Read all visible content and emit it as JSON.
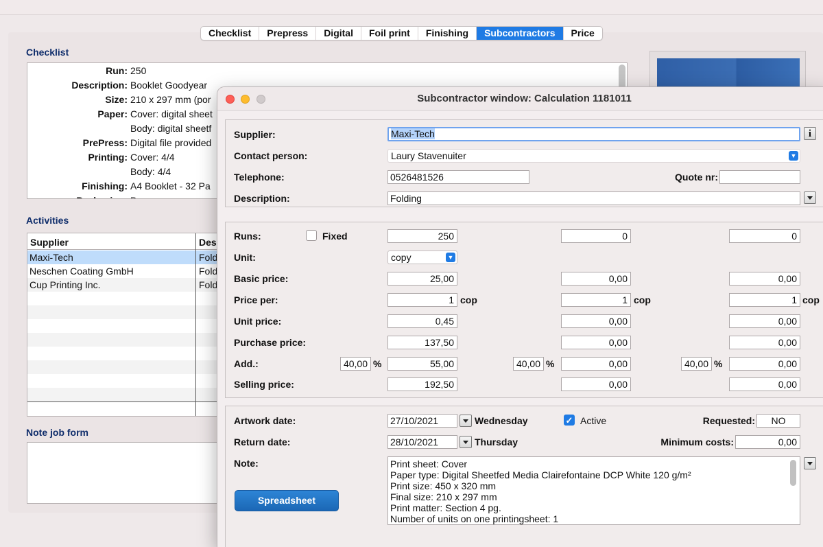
{
  "tabs": [
    "Checklist",
    "Prepress",
    "Digital",
    "Foil print",
    "Finishing",
    "Subcontractors",
    "Price"
  ],
  "active_tab": "Subcontractors",
  "checklist": {
    "title": "Checklist",
    "rows": [
      {
        "label": "Run:",
        "value": "250"
      },
      {
        "label": "Description:",
        "value": "Booklet Goodyear"
      },
      {
        "label": "Size:",
        "value": "210 x 297 mm (por"
      },
      {
        "label": "Paper:",
        "value": "Cover: digital sheet"
      },
      {
        "label": "",
        "value": "Body: digital sheetf"
      },
      {
        "label": "PrePress:",
        "value": "Digital file provided"
      },
      {
        "label": "Printing:",
        "value": "Cover: 4/4"
      },
      {
        "label": "",
        "value": "Body: 4/4"
      },
      {
        "label": "Finishing:",
        "value": "A4 Booklet - 32 Pa"
      },
      {
        "label": "Packaging:",
        "value": "Box"
      }
    ]
  },
  "activities": {
    "title": "Activities",
    "col_supplier": "Supplier",
    "col_desc": "Des",
    "rows": [
      {
        "supplier": "Maxi-Tech",
        "desc": "Fold"
      },
      {
        "supplier": "Neschen Coating GmbH",
        "desc": "Fold"
      },
      {
        "supplier": "Cup Printing Inc.",
        "desc": "Fold"
      }
    ]
  },
  "note_job_form": {
    "title": "Note job form"
  },
  "window": {
    "title": "Subcontractor window: Calculation 1181011",
    "supplier_label": "Supplier:",
    "supplier_value": "Maxi-Tech",
    "info_label": "i",
    "contact_label": "Contact person:",
    "contact_value": "Laury Stavenuiter",
    "telephone_label": "Telephone:",
    "telephone_value": "0526481526",
    "quote_label": "Quote nr:",
    "quote_value": "",
    "description_label": "Description:",
    "description_value": "Folding",
    "runs_label": "Runs:",
    "fixed_label": "Fixed",
    "runs": [
      "250",
      "0",
      "0"
    ],
    "unit_label": "Unit:",
    "unit_value": "copy",
    "basic_price_label": "Basic price:",
    "basic_price": [
      "25,00",
      "0,00",
      "0,00"
    ],
    "price_per_label": "Price per:",
    "price_per": [
      "1",
      "1",
      "1"
    ],
    "price_per_unit": "cop",
    "unit_price_label": "Unit price:",
    "unit_price": [
      "0,45",
      "0,00",
      "0,00"
    ],
    "purchase_price_label": "Purchase price:",
    "purchase_price": [
      "137,50",
      "0,00",
      "0,00"
    ],
    "add_label": "Add.:",
    "add_pct": [
      "40,00",
      "40,00",
      "40,00"
    ],
    "pct_sign": "%",
    "add_values": [
      "55,00",
      "0,00",
      "0,00"
    ],
    "selling_price_label": "Selling price:",
    "selling_price": [
      "192,50",
      "0,00",
      "0,00"
    ],
    "artwork_label": "Artwork date:",
    "artwork_date": "27/10/2021",
    "artwork_day": "Wednesday",
    "active_label": "Active",
    "active_checked": true,
    "requested_label": "Requested:",
    "requested_value": "NO",
    "return_label": "Return date:",
    "return_date": "28/10/2021",
    "return_day": "Thursday",
    "min_costs_label": "Minimum costs:",
    "min_costs_value": "0,00",
    "note_label": "Note:",
    "note_lines": [
      "Print sheet: Cover",
      "Paper type: Digital Sheetfed Media Clairefontaine DCP White 120 g/m²",
      "Print size: 450 x 320 mm",
      "Final size: 210 x 297 mm",
      "Print matter: Section 4 pg.",
      "Number of units on one printingsheet: 1"
    ],
    "spreadsheet_label": "Spreadsheet"
  },
  "colors": {
    "accent": "#1f7be4",
    "section_title": "#0f2d6b",
    "selection": "#bfdcfb"
  }
}
